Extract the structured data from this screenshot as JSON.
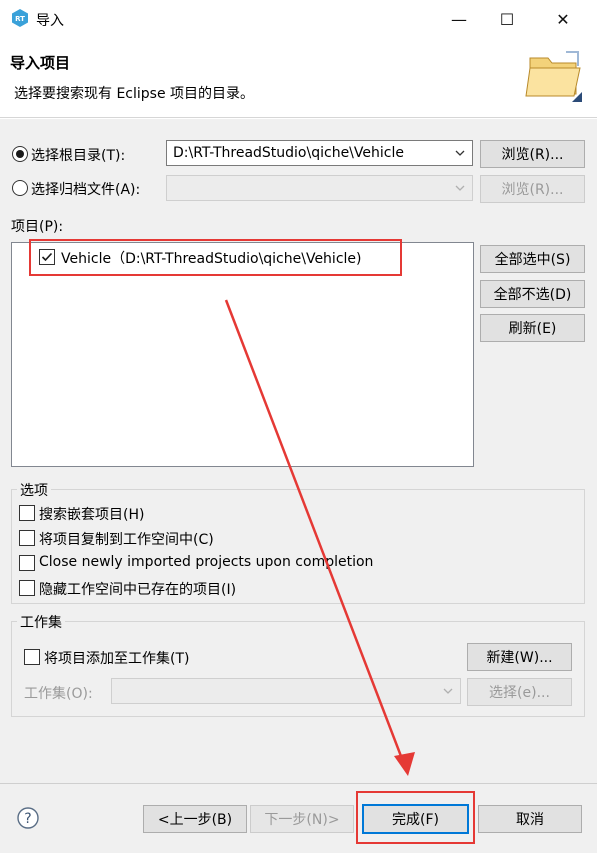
{
  "window": {
    "title": "导入",
    "minimize_label": "—",
    "maximize_label": "☐",
    "close_label": "✕"
  },
  "header": {
    "title": "导入项目",
    "description": "选择要搜索现有 Eclipse 项目的目录。"
  },
  "source": {
    "root_dir_label": "选择根目录(T):",
    "root_dir_value": "D:\\RT-ThreadStudio\\qiche\\Vehicle",
    "browse1_label": "浏览(R)...",
    "archive_label": "选择归档文件(A):",
    "archive_value": "",
    "browse2_label": "浏览(R)...",
    "selected": "root_dir"
  },
  "projects": {
    "label": "项目(P):",
    "items": [
      {
        "name": "Vehicle（D:\\RT-ThreadStudio\\qiche\\Vehicle)",
        "checked": true
      }
    ],
    "select_all_label": "全部选中(S)",
    "deselect_all_label": "全部不选(D)",
    "refresh_label": "刷新(E)"
  },
  "options": {
    "title": "选项",
    "items": [
      {
        "label": "搜索嵌套项目(H)",
        "checked": false
      },
      {
        "label": "将项目复制到工作空间中(C)",
        "checked": false
      },
      {
        "label": "Close newly imported projects upon completion",
        "checked": false
      },
      {
        "label": "隐藏工作空间中已存在的项目(I)",
        "checked": false
      }
    ]
  },
  "working_sets": {
    "title": "工作集",
    "add_label": "将项目添加至工作集(T)",
    "add_checked": false,
    "new_label": "新建(W)...",
    "sets_label": "工作集(O):",
    "sets_value": "",
    "select_label": "选择(e)..."
  },
  "footer": {
    "help_label": "?",
    "back_label": "<上一步(B)",
    "next_label": "下一步(N)>",
    "finish_label": "完成(F)",
    "cancel_label": "取消"
  },
  "colors": {
    "accent": "#0078d7",
    "annotation_red": "#e53935",
    "dialog_bg": "#f0f0f0"
  }
}
